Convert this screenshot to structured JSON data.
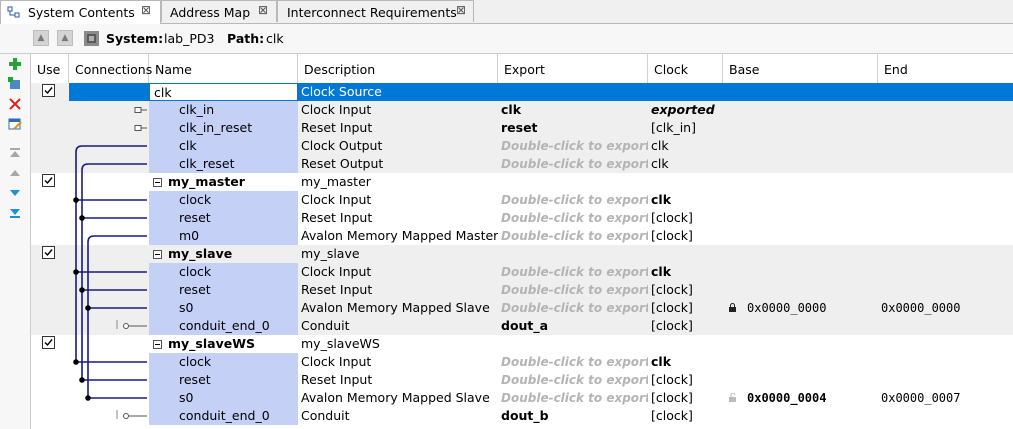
{
  "tabs": [
    {
      "label": "System Contents",
      "active": true
    },
    {
      "label": "Address Map",
      "active": false
    },
    {
      "label": "Interconnect Requirements",
      "active": false
    }
  ],
  "pathbar": {
    "system_label": "System:",
    "system_value": "lab_PD3",
    "path_label": "Path:",
    "path_value": "clk"
  },
  "columns": [
    "Use",
    "Connections",
    "Name",
    "Description",
    "Export",
    "Clock",
    "Base",
    "End"
  ],
  "rows": [
    {
      "kind": "comp",
      "name": "clk",
      "desc": "Clock Source",
      "export": "",
      "clock": "",
      "base": "",
      "end": "",
      "selected": true,
      "use": true
    },
    {
      "kind": "port",
      "name": "clk_in",
      "desc": "Clock Input",
      "export": "clk",
      "export_style": "bold",
      "clock": "exported",
      "clock_style": "exported",
      "base": "",
      "end": "",
      "conn": "open"
    },
    {
      "kind": "port",
      "name": "clk_in_reset",
      "desc": "Reset Input",
      "export": "reset",
      "export_style": "bold",
      "clock": "[clk_in]",
      "base": "",
      "end": "",
      "conn": "open"
    },
    {
      "kind": "port",
      "name": "clk",
      "desc": "Clock Output",
      "export": "Double-click to export",
      "export_style": "dbl",
      "clock": "clk",
      "base": "",
      "end": ""
    },
    {
      "kind": "port",
      "name": "clk_reset",
      "desc": "Reset Output",
      "export": "Double-click to export",
      "export_style": "dbl",
      "clock": "clk",
      "base": "",
      "end": ""
    },
    {
      "kind": "comp",
      "name": "my_master",
      "desc": "my_master",
      "export": "",
      "clock": "",
      "base": "",
      "end": "",
      "use": true
    },
    {
      "kind": "port",
      "name": "clock",
      "desc": "Clock Input",
      "export": "Double-click to export",
      "export_style": "dbl",
      "clock": "clk",
      "clock_style": "bold",
      "base": "",
      "end": ""
    },
    {
      "kind": "port",
      "name": "reset",
      "desc": "Reset Input",
      "export": "Double-click to export",
      "export_style": "dbl",
      "clock": "[clock]",
      "base": "",
      "end": ""
    },
    {
      "kind": "port",
      "name": "m0",
      "desc": "Avalon Memory Mapped Master",
      "export": "Double-click to export",
      "export_style": "dbl",
      "clock": "[clock]",
      "base": "",
      "end": ""
    },
    {
      "kind": "comp",
      "name": "my_slave",
      "desc": "my_slave",
      "export": "",
      "clock": "",
      "base": "",
      "end": "",
      "use": true
    },
    {
      "kind": "port",
      "name": "clock",
      "desc": "Clock Input",
      "export": "Double-click to export",
      "export_style": "dbl",
      "clock": "clk",
      "clock_style": "bold",
      "base": "",
      "end": ""
    },
    {
      "kind": "port",
      "name": "reset",
      "desc": "Reset Input",
      "export": "Double-click to export",
      "export_style": "dbl",
      "clock": "[clock]",
      "base": "",
      "end": ""
    },
    {
      "kind": "port",
      "name": "s0",
      "desc": "Avalon Memory Mapped Slave",
      "export": "Double-click to export",
      "export_style": "dbl",
      "clock": "[clock]",
      "base": "0x0000_0000",
      "end": "0x0000_0000",
      "lock": true
    },
    {
      "kind": "port",
      "name": "conduit_end_0",
      "desc": "Conduit",
      "export": "dout_a",
      "export_style": "bold",
      "clock": "[clock]",
      "base": "",
      "end": "",
      "conn": "open"
    },
    {
      "kind": "comp",
      "name": "my_slaveWS",
      "desc": "my_slaveWS",
      "export": "",
      "clock": "",
      "base": "",
      "end": "",
      "use": true
    },
    {
      "kind": "port",
      "name": "clock",
      "desc": "Clock Input",
      "export": "Double-click to export",
      "export_style": "dbl",
      "clock": "clk",
      "clock_style": "bold",
      "base": "",
      "end": ""
    },
    {
      "kind": "port",
      "name": "reset",
      "desc": "Reset Input",
      "export": "Double-click to export",
      "export_style": "dbl",
      "clock": "[clock]",
      "base": "",
      "end": ""
    },
    {
      "kind": "port",
      "name": "s0",
      "desc": "Avalon Memory Mapped Slave",
      "export": "Double-click to export",
      "export_style": "dbl",
      "clock": "[clock]",
      "base": "0x0000_0004",
      "base_style": "bold",
      "end": "0x0000_0007",
      "lock": true,
      "lock_open": true
    },
    {
      "kind": "port",
      "name": "conduit_end_0",
      "desc": "Conduit",
      "export": "dout_b",
      "export_style": "bold",
      "clock": "[clock]",
      "base": "",
      "end": "",
      "conn": "open"
    }
  ],
  "colors": {
    "selection": "#0078d7",
    "name_highlight": "#c4d0f6",
    "group_band": "#efefef",
    "connection_line": "#1a1a80"
  },
  "icons": {
    "toolbar": [
      "add-icon",
      "add-component-icon",
      "remove-icon",
      "edit-icon",
      "move-top-icon",
      "move-up-icon",
      "move-down-icon",
      "move-bottom-icon"
    ]
  }
}
